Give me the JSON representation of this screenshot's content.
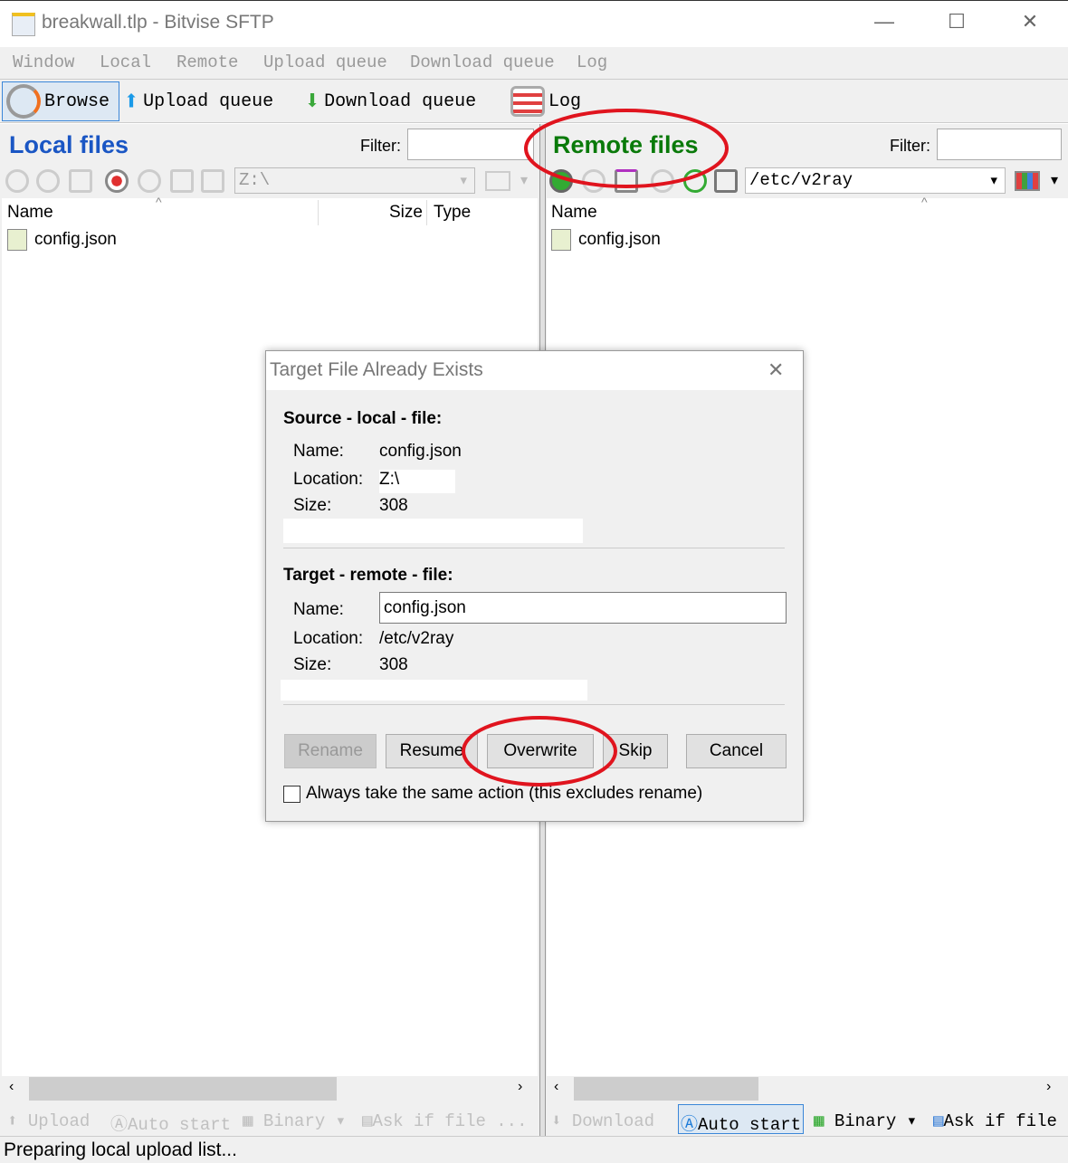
{
  "window": {
    "title": "breakwall.tlp - Bitvise SFTP",
    "minimize": "—",
    "maximize": "☐",
    "close": "✕"
  },
  "menu": [
    "Window",
    "Local",
    "Remote",
    "Upload queue",
    "Download queue",
    "Log"
  ],
  "toolbar": {
    "browse": "Browse",
    "upload_queue": "Upload queue",
    "download_queue": "Download queue",
    "log": "Log"
  },
  "local": {
    "title": "Local files",
    "filter_label": "Filter:",
    "filter_value": "",
    "path": "Z:\\",
    "columns": [
      "Name",
      "Size",
      "Type"
    ],
    "files": [
      {
        "name": "config.json"
      }
    ],
    "bottom": {
      "upload": "Upload",
      "auto_start": "Auto start",
      "binary": "Binary",
      "ask": "Ask if file ..."
    }
  },
  "remote": {
    "title": "Remote files",
    "filter_label": "Filter:",
    "filter_value": "",
    "path": "/etc/v2ray",
    "columns": [
      "Name"
    ],
    "files": [
      {
        "name": "config.json"
      }
    ],
    "bottom": {
      "download": "Download",
      "auto_start": "Auto start",
      "binary": "Binary",
      "ask": "Ask if file"
    }
  },
  "status": "Preparing local upload list...",
  "colors": {
    "local_title": "#1a56c4",
    "remote_title": "#0a7a0a",
    "annotation": "#e0141e"
  },
  "dialog": {
    "title": "Target File Already Exists",
    "source": {
      "heading": "Source - local - file:",
      "name_label": "Name:",
      "name": "config.json",
      "location_label": "Location:",
      "location": "Z:\\",
      "size_label": "Size:",
      "size": "308"
    },
    "target": {
      "heading": "Target - remote - file:",
      "name_label": "Name:",
      "name": "config.json",
      "location_label": "Location:",
      "location": "/etc/v2ray",
      "size_label": "Size:",
      "size": "308"
    },
    "buttons": {
      "rename": "Rename",
      "resume": "Resume",
      "overwrite": "Overwrite",
      "skip": "Skip",
      "cancel": "Cancel"
    },
    "checkbox": {
      "label": "Always take the same action (this excludes rename)",
      "checked": false
    }
  }
}
